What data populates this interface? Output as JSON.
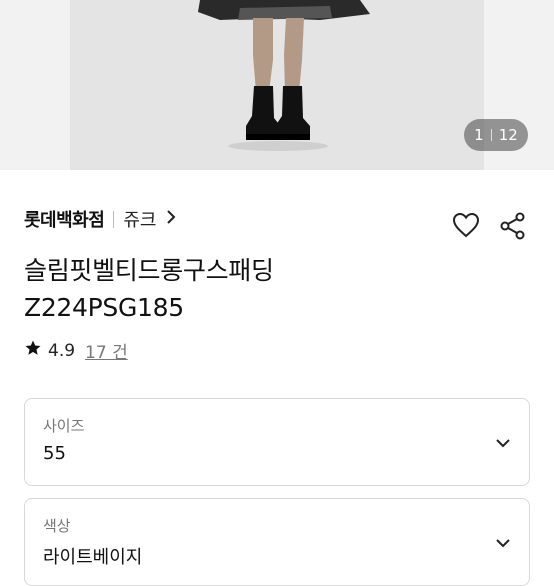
{
  "gallery": {
    "current": "1",
    "total": "12"
  },
  "brand": {
    "store": "롯데백화점",
    "sub": "쥬크"
  },
  "product": {
    "name": "슬림핏벨티드롱구스패딩",
    "code": "Z224PSG185"
  },
  "rating": {
    "score": "4.9",
    "count": "17 건"
  },
  "options": [
    {
      "label": "사이즈",
      "value": "55"
    },
    {
      "label": "색상",
      "value": "라이트베이지"
    }
  ],
  "icons": {
    "wishlist": "heart-icon",
    "share": "share-icon",
    "rating": "star-icon",
    "dropdown": "chevron-down-icon",
    "brand_link": "chevron-right-icon"
  }
}
